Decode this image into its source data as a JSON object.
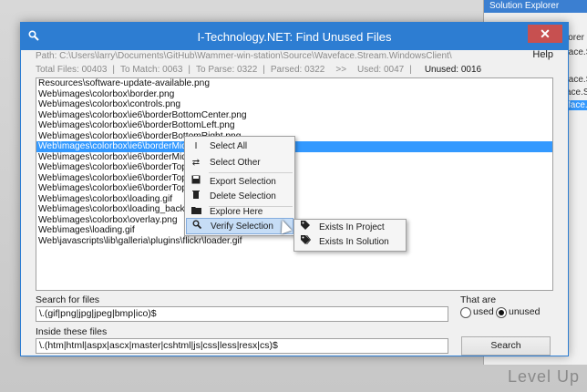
{
  "background": {
    "solution_explorer_title": "Solution Explorer",
    "side_texts": [
      "lorer",
      "face.S",
      "face.Stre",
      "ace.Stre",
      "face.Stre"
    ],
    "watermark": "Level Up"
  },
  "window": {
    "title": "I-Technology.NET: Find Unused Files",
    "close_glyph": "✕",
    "help_label": "Help"
  },
  "path": "Path: C:\\Users\\larry\\Documents\\GitHub\\Wammer-win-station\\Source\\Waveface.Stream.WindowsClient\\",
  "stats": {
    "total": "Total Files: 00403",
    "to_match": "To Match: 0063",
    "to_parse": "To Parse: 0322",
    "parsed": "Parsed: 0322",
    "arrows": ">>",
    "used": "Used: 0047",
    "unused": "Unused: 0016"
  },
  "files": [
    "Resources\\software-update-available.png",
    "Web\\images\\colorbox\\border.png",
    "Web\\images\\colorbox\\controls.png",
    "Web\\images\\colorbox\\ie6\\borderBottomCenter.png",
    "Web\\images\\colorbox\\ie6\\borderBottomLeft.png",
    "Web\\images\\colorbox\\ie6\\borderBottomRight.png",
    "Web\\images\\colorbox\\ie6\\borderMiddleLeft.png",
    "Web\\images\\colorbox\\ie6\\borderMiddleRight.png",
    "Web\\images\\colorbox\\ie6\\borderTopCenter.png",
    "Web\\images\\colorbox\\ie6\\borderTopLeft.png",
    "Web\\images\\colorbox\\ie6\\borderTopRight.png",
    "Web\\images\\colorbox\\loading.gif",
    "Web\\images\\colorbox\\loading_background.png",
    "Web\\images\\colorbox\\overlay.png",
    "Web\\images\\loading.gif",
    "Web\\javascripts\\lib\\galleria\\plugins\\flickr\\loader.gif"
  ],
  "selected_index": 6,
  "context_menu": {
    "select_all": "Select All",
    "select_other": "Select Other",
    "export_selection": "Export Selection",
    "delete_selection": "Delete Selection",
    "explore_here": "Explore Here",
    "verify_selection": "Verify Selection",
    "submenu_arrow": "▶"
  },
  "submenu": {
    "exists_in_project": "Exists In Project",
    "exists_in_solution": "Exists In Solution"
  },
  "search": {
    "label": "Search for files",
    "value": "\\.(gif|png|jpg|jpeg|bmp|ico)$"
  },
  "inside": {
    "label": "Inside these files",
    "value": "\\.(htm|html|aspx|ascx|master|cshtml|js|css|less|resx|cs)$"
  },
  "filter": {
    "label": "That are",
    "used": "used",
    "unused": "unused",
    "selected": "unused"
  },
  "search_button": "Search",
  "colors": {
    "titlebar": "#2d7dd2",
    "selection": "#3399ff",
    "close": "#c75050"
  }
}
